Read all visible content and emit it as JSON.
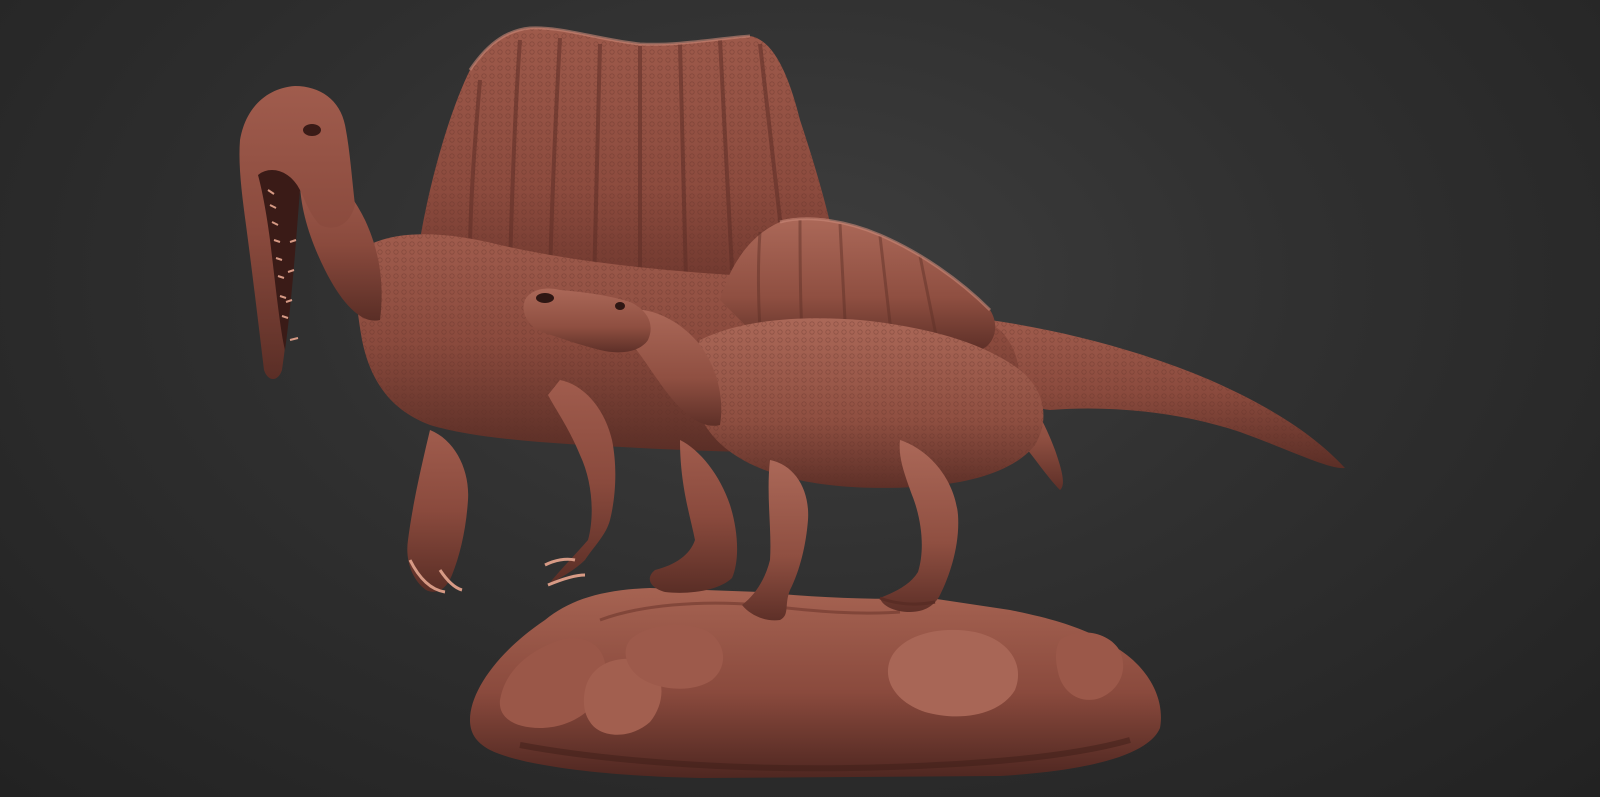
{
  "scene": {
    "subject": "",
    "colors": {
      "background_center": "#3e3e3e",
      "background_edge": "#222222",
      "clay_base": "#8a4a3d",
      "clay_light": "#b06a5a",
      "clay_dark": "#4a2520",
      "clay_shadow": "#2e1613"
    }
  }
}
